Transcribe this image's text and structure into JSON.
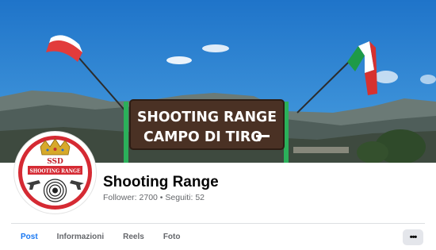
{
  "cover": {
    "sign_line1": "SHOOTING RANGE",
    "sign_line2": "CAMPO DI TIRO",
    "colors": {
      "sky": "#2f86d6",
      "sign": "#4a3124",
      "post": "#2bb05a"
    }
  },
  "avatar": {
    "logo_line1": "SSD",
    "logo_line2": "SHOOTING RANGE",
    "colors": {
      "ring": "#d52a33",
      "crown": "#d7a92a"
    }
  },
  "profile": {
    "name": "Shooting Range",
    "stats": "Follower: 2700 • Seguiti: 52"
  },
  "tabs": [
    {
      "label": "Post",
      "active": true
    },
    {
      "label": "Informazioni",
      "active": false
    },
    {
      "label": "Reels",
      "active": false
    },
    {
      "label": "Foto",
      "active": false
    }
  ],
  "more_button": {
    "label": "•••",
    "icon": "more-dots-icon"
  },
  "colors": {
    "accent": "#1877f2",
    "muted": "#65676b",
    "text": "#050505"
  }
}
